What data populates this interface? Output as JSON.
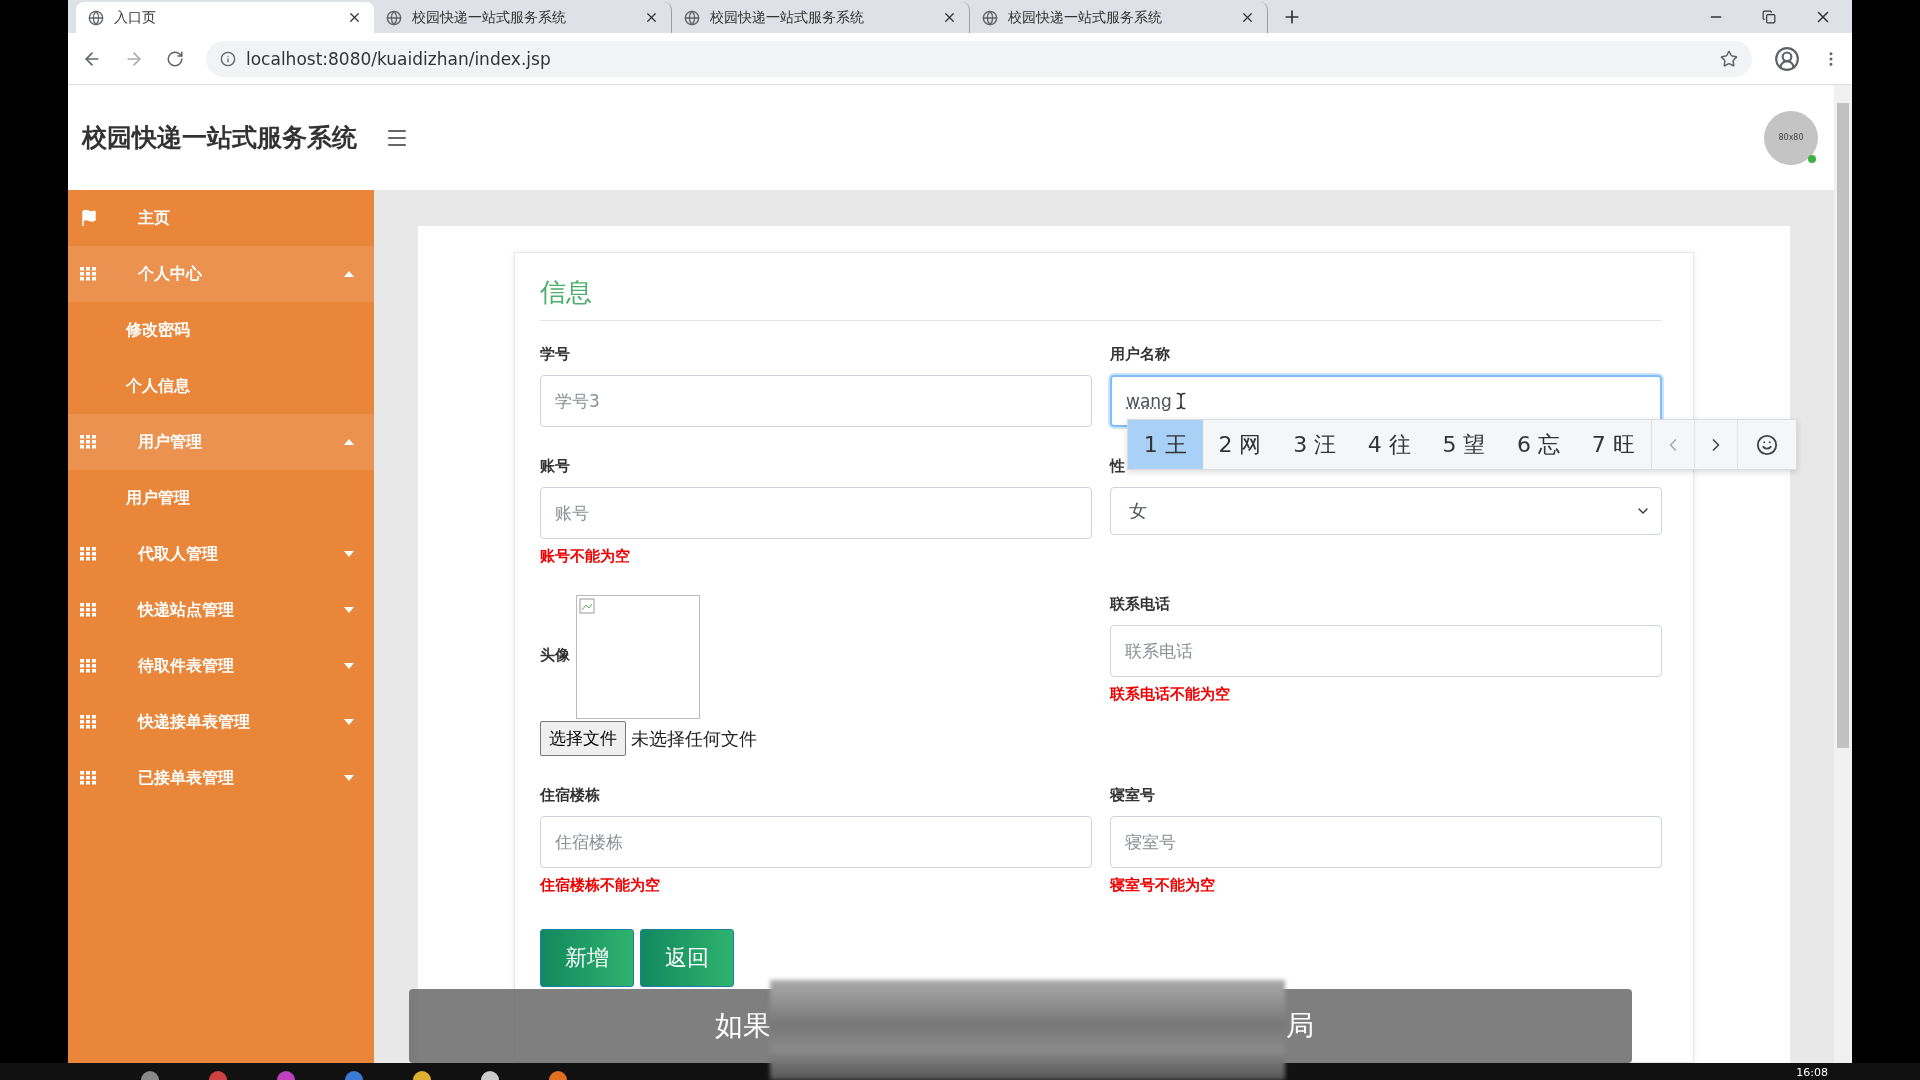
{
  "browser": {
    "tabs": [
      {
        "title": "入口页",
        "selected": true
      },
      {
        "title": "校园快递一站式服务系统",
        "selected": false
      },
      {
        "title": "校园快递一站式服务系统",
        "selected": false
      },
      {
        "title": "校园快递一站式服务系统",
        "selected": false
      }
    ],
    "url": "localhost:8080/kuaidizhan/index.jsp"
  },
  "header": {
    "title": "校园快递一站式服务系统",
    "avatar": "80x80"
  },
  "sidebar": {
    "items": [
      {
        "kind": "link",
        "label": "主页"
      },
      {
        "kind": "group",
        "label": "个人中心",
        "expanded": true,
        "children": [
          {
            "label": "修改密码"
          },
          {
            "label": "个人信息"
          }
        ]
      },
      {
        "kind": "group",
        "label": "用户管理",
        "expanded": true,
        "children": [
          {
            "label": "用户管理"
          }
        ]
      },
      {
        "kind": "group",
        "label": "代取人管理",
        "expanded": false
      },
      {
        "kind": "group",
        "label": "快递站点管理",
        "expanded": false
      },
      {
        "kind": "group",
        "label": "待取件表管理",
        "expanded": false
      },
      {
        "kind": "group",
        "label": "快递接单表管理",
        "expanded": false
      },
      {
        "kind": "group",
        "label": "已接单表管理",
        "expanded": false
      }
    ]
  },
  "form": {
    "title": "信息",
    "columns": [
      {
        "fields": [
          {
            "kind": "text",
            "label": "学号",
            "placeholder": "学号3"
          },
          {
            "kind": "text",
            "label": "账号",
            "placeholder": "账号",
            "error": "账号不能为空"
          },
          {
            "kind": "avatar",
            "label": "头像",
            "file_button": "选择文件",
            "file_status": "未选择任何文件"
          },
          {
            "kind": "text",
            "label": "住宿楼栋",
            "placeholder": "住宿楼栋",
            "error": "住宿楼栋不能为空"
          }
        ]
      },
      {
        "fields": [
          {
            "kind": "text",
            "label": "用户名称",
            "value": "wang",
            "focused": true
          },
          {
            "kind": "select",
            "label": "性",
            "value": "女"
          },
          {
            "kind": "text",
            "label": "联系电话",
            "placeholder": "联系电话",
            "error": "联系电话不能为空"
          },
          {
            "kind": "text",
            "label": "寝室号",
            "placeholder": "寝室号",
            "error": "寝室号不能为空"
          }
        ]
      }
    ],
    "buttons": [
      "新增",
      "返回"
    ]
  },
  "ime": {
    "candidates": [
      {
        "text": "1 王",
        "selected": true
      },
      {
        "text": "2 网",
        "selected": false
      },
      {
        "text": "3 汪",
        "selected": false
      },
      {
        "text": "4 往",
        "selected": false
      },
      {
        "text": "5 望",
        "selected": false
      },
      {
        "text": "6 忘",
        "selected": false
      },
      {
        "text": "7 旺",
        "selected": false
      }
    ]
  },
  "subtitle": {
    "start": "如果",
    "end": "局"
  },
  "taskbar": {
    "clock": "16:08"
  }
}
